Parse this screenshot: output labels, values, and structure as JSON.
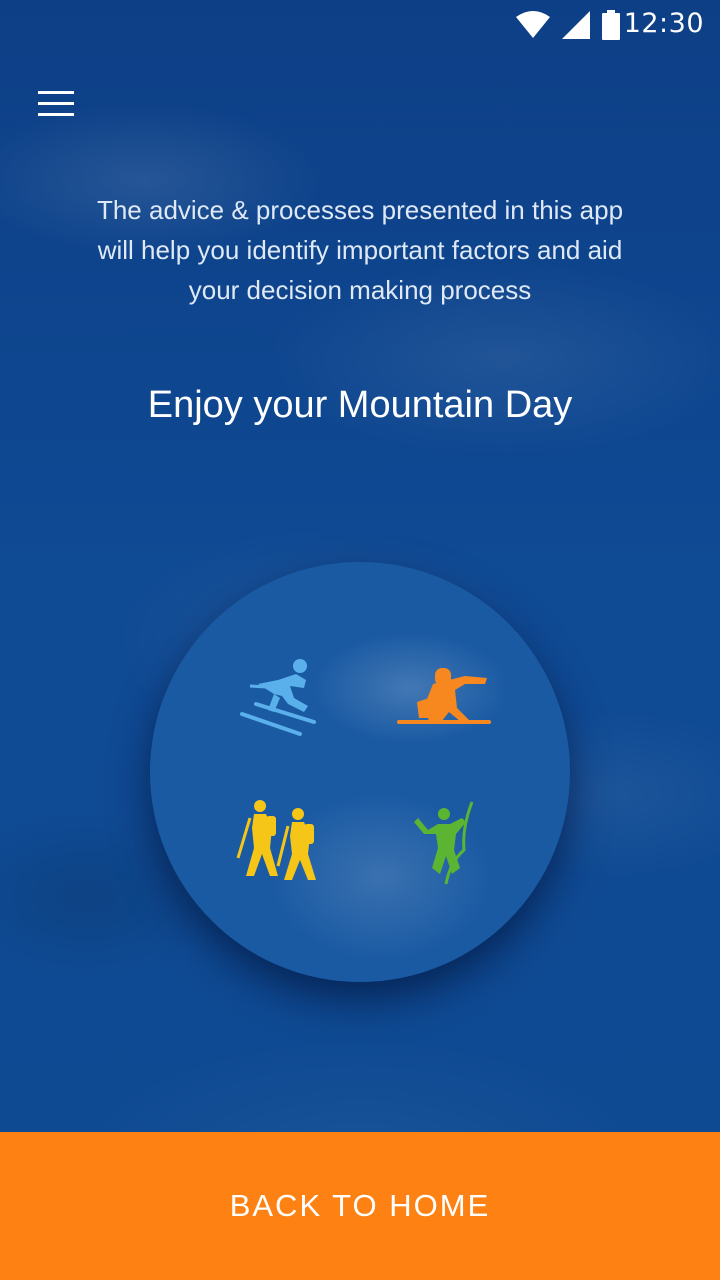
{
  "status_bar": {
    "time": "12:30",
    "icons": [
      "wifi-icon",
      "signal-icon",
      "battery-icon"
    ]
  },
  "menu": {
    "icon": "hamburger-menu-icon"
  },
  "main": {
    "intro": "The advice & processes presented in this app will help you identify important factors and aid your decision making process",
    "headline": "Enjoy your Mountain Day",
    "activities": [
      {
        "name": "skiing",
        "icon": "skier-icon",
        "color": "#5ab0ea"
      },
      {
        "name": "snowboarding",
        "icon": "snowboarder-icon",
        "color": "#f7881f"
      },
      {
        "name": "hiking",
        "icon": "hikers-icon",
        "color": "#f5c518"
      },
      {
        "name": "climbing",
        "icon": "climber-icon",
        "color": "#5bb532"
      }
    ]
  },
  "footer": {
    "button_label": "BACK TO HOME"
  },
  "colors": {
    "background": "#0f4a94",
    "accent": "#fd8213"
  }
}
